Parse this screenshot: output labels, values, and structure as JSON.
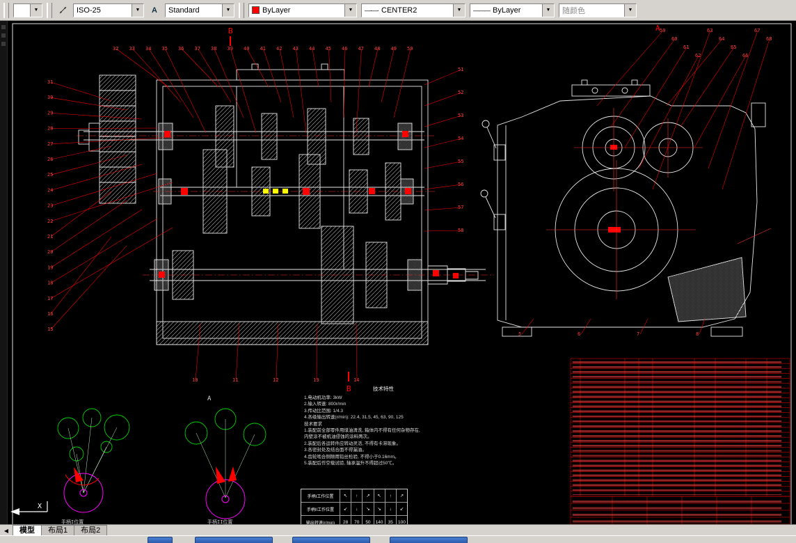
{
  "toolbar": {
    "mini_combo_value": "",
    "dim_style": "ISO-25",
    "text_style": "Standard",
    "color": "ByLayer",
    "linetype": "CENTER2",
    "linetype_glyph": "—·—·",
    "lineweight": "ByLayer",
    "lineweight_glyph": "———",
    "plot_style": "随颜色",
    "combo_arrow": "▼"
  },
  "drawing": {
    "section_labels": {
      "top_b": "B",
      "bottom_b": "B",
      "right_a": "A",
      "diagram_a": "A"
    },
    "ucs_x": "X",
    "diagram_captions": [
      "手柄I位置",
      "手柄II位置"
    ],
    "balloons": {
      "left": [
        "31",
        "30",
        "29",
        "28",
        "27",
        "26",
        "25",
        "24",
        "23",
        "22",
        "21",
        "20",
        "19",
        "18",
        "17",
        "16",
        "15"
      ],
      "top": [
        "32",
        "33",
        "34",
        "35",
        "36",
        "37",
        "38",
        "39",
        "40",
        "41",
        "42",
        "43",
        "44",
        "45",
        "46",
        "47",
        "48",
        "49",
        "50"
      ],
      "mid": [
        "51",
        "52",
        "53",
        "54",
        "55",
        "56",
        "57",
        "58"
      ],
      "right_top": [
        "59",
        "60",
        "61",
        "62",
        "63",
        "64",
        "65",
        "66",
        "67",
        "68"
      ],
      "bottom": [
        "10",
        "11",
        "12",
        "13",
        "14"
      ],
      "right_bottom": [
        "5",
        "6",
        "7",
        "8"
      ]
    },
    "notes": {
      "title": "技术特性",
      "lines": [
        "1.电动机功率: 3kW",
        "2.输入转速: 800r/min",
        "3.传动比范围: 1/4.3",
        "4.各级输出转速(r/min): 22.4, 31.5, 45, 63, 90, 125",
        "技术要求",
        "1.装配前全部零件用煤油清洗, 箱体内不得有任何杂物存在,",
        "  内壁涂不被机油侵蚀的涂料两次。",
        "2.装配后各运转件应转动灵活, 不得有卡滞现象。",
        "3.各密封处及结合面不得漏油。",
        "4.齿轮啮合侧隙用铅丝检验, 不得小于0.16mm。",
        "5.装配后作空载试验, 轴承温升不得超过50℃。"
      ]
    },
    "speed_table": {
      "row_labels": [
        "手柄I工作位置",
        "手柄II工作位置",
        "输出转速(r/min)"
      ],
      "symbols_row1": [
        "↖",
        "↑",
        "↗",
        "↖",
        "↑",
        "↗"
      ],
      "symbols_row2": [
        "↙",
        "↓",
        "↘",
        "↘",
        "↓",
        "↙"
      ],
      "speeds": [
        "28",
        "70",
        "50",
        "140",
        "35",
        "100"
      ]
    }
  },
  "tabs": {
    "nav": "◀",
    "items": [
      "模型",
      "布局1",
      "布局2"
    ]
  }
}
